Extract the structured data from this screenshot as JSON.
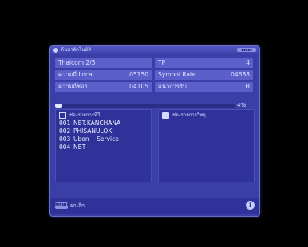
{
  "title_bar": {
    "title": "ค้นหาอัตโนมัติ",
    "badge": "▪▪▪▪▪"
  },
  "info": {
    "satellite": "Thaicom 2/5",
    "tp_label": "TP",
    "tp_value": "4",
    "lnb_local_label": "ความถี่ Local",
    "lnb_local_value": "05150",
    "symbol_rate_label": "Symbol Rate",
    "symbol_rate_value": "04688",
    "frequency_label": "ความถี่ช่อง",
    "frequency_value": "04105",
    "polarity_label": "แนวการรับ",
    "polarity_value": "H"
  },
  "progress": {
    "percent": 4,
    "label": "4%"
  },
  "tv_panel": {
    "header": "ช่องรายการทีวี",
    "items": [
      {
        "num": "001",
        "name": "NBT.KANCHANA"
      },
      {
        "num": "002",
        "name": "PHISANULOK"
      },
      {
        "num": "003",
        "name": "Ubon    Service"
      },
      {
        "num": "004",
        "name": "NBT"
      }
    ]
  },
  "radio_panel": {
    "header": "ช่องรายการวิทยุ",
    "items": []
  },
  "footer": {
    "menu_key": "MENU",
    "menu_text": "ยกเลิก",
    "info_icon": "i"
  },
  "colors": {
    "osd_background": "#3a3fa8",
    "cell_background": "#5a5fc9",
    "panel_background": "#2f3399"
  }
}
